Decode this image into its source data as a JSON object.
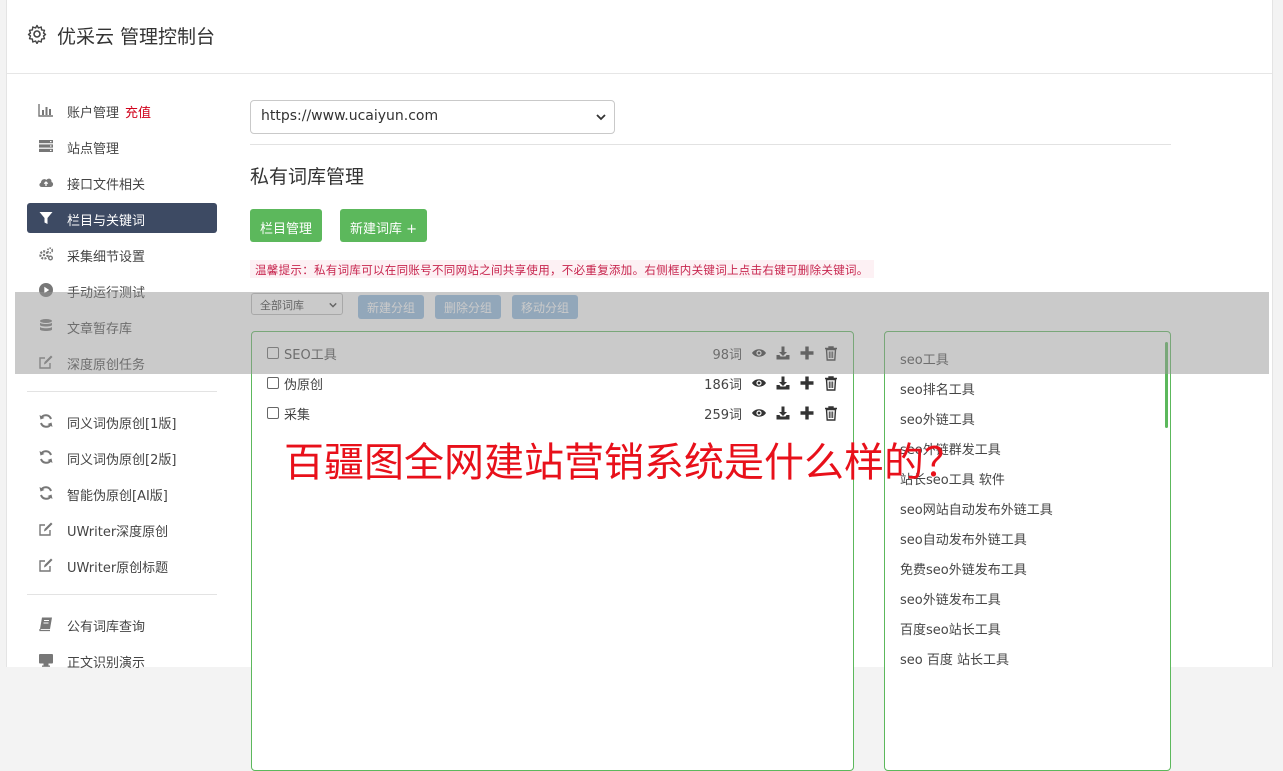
{
  "header": {
    "title": "优采云 管理控制台",
    "icon": "gear-icon"
  },
  "sidebar": {
    "group1": [
      {
        "label": "账户管理",
        "badge": "充值",
        "icon": "bar-chart-icon"
      },
      {
        "label": "站点管理",
        "icon": "server-icon"
      },
      {
        "label": "接口文件相关",
        "icon": "cloud-upload-icon"
      },
      {
        "label": "栏目与关键词",
        "icon": "filter-icon",
        "active": true
      },
      {
        "label": "采集细节设置",
        "icon": "cogs-icon"
      },
      {
        "label": "手动运行测试",
        "icon": "play-circle-icon"
      },
      {
        "label": "文章暂存库",
        "icon": "database-icon"
      },
      {
        "label": "深度原创任务",
        "icon": "edit-icon"
      }
    ],
    "group2": [
      {
        "label": "同义词伪原创[1版]",
        "icon": "refresh-icon"
      },
      {
        "label": "同义词伪原创[2版]",
        "icon": "refresh-icon"
      },
      {
        "label": "智能伪原创[AI版]",
        "icon": "refresh-icon"
      },
      {
        "label": "UWriter深度原创",
        "icon": "edit-icon"
      },
      {
        "label": "UWriter原创标题",
        "icon": "edit-icon"
      }
    ],
    "group3": [
      {
        "label": "公有词库查询",
        "icon": "book-icon"
      },
      {
        "label": "正文识别演示",
        "icon": "monitor-icon"
      }
    ]
  },
  "main": {
    "site_select": {
      "value": "https://www.ucaiyun.com"
    },
    "section_title": "私有词库管理",
    "buttons": {
      "column_manage": "栏目管理",
      "new_library": "新建词库 +"
    },
    "tip": "温馨提示：私有词库可以在同账号不同网站之间共享使用，不必重复添加。右侧框内关键词上点击右键可删除关键词。",
    "group_select": {
      "value": "全部词库"
    },
    "group_buttons": {
      "new_group": "新建分组",
      "delete_group": "删除分组",
      "move_group": "移动分组"
    },
    "libraries": [
      {
        "name": "SEO工具",
        "count": "98词"
      },
      {
        "name": "伪原创",
        "count": "186词"
      },
      {
        "name": "采集",
        "count": "259词"
      }
    ],
    "keywords": [
      "seo工具",
      "seo排名工具",
      "seo外链工具",
      "seo外链群发工具",
      "站长seo工具 软件",
      "seo网站自动发布外链工具",
      "seo自动发布外链工具",
      "免费seo外链发布工具",
      "seo外链发布工具",
      "百度seo站长工具",
      "seo 百度 站长工具"
    ]
  },
  "overlay_headline": "百疆图全网建站营销系统是什么样的？",
  "colors": {
    "active_nav": "#3d4a63",
    "green": "#5cb85c",
    "blue_btn": "#8eb8df",
    "tip_text": "#c7254e",
    "headline": "#e8101a"
  }
}
